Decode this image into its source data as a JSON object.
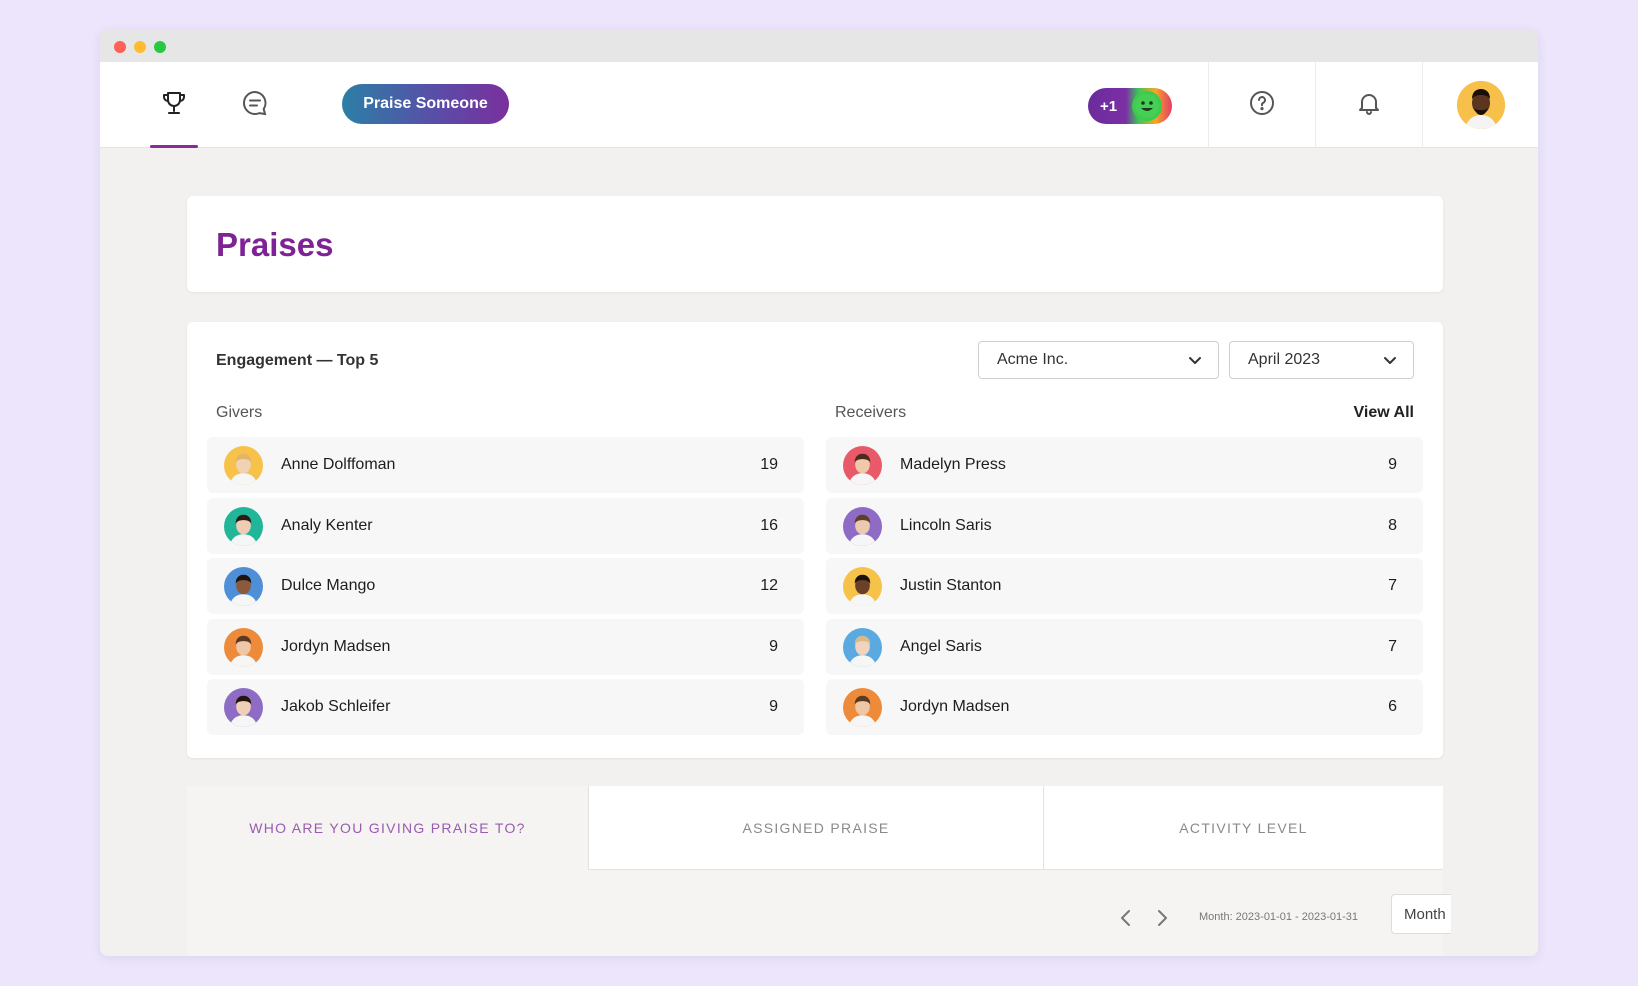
{
  "nav": {
    "praise_button": "Praise Someone",
    "plus_badge": "+1",
    "icons": [
      "trophy-icon",
      "chat-icon",
      "help-icon",
      "bell-icon"
    ]
  },
  "page": {
    "title": "Praises"
  },
  "engagement": {
    "title": "Engagement — Top 5",
    "company_select": "Acme Inc.",
    "month_select": "April 2023",
    "givers_label": "Givers",
    "receivers_label": "Receivers",
    "view_all": "View All",
    "givers": [
      {
        "name": "Anne Dolffoman",
        "count": "19",
        "bg": "#f6c24a",
        "skin": "#f2d2b5",
        "hair": "#e3b46c"
      },
      {
        "name": "Analy Kenter",
        "count": "16",
        "bg": "#21b59a",
        "skin": "#f0cdb2",
        "hair": "#2b1c16"
      },
      {
        "name": "Dulce Mango",
        "count": "12",
        "bg": "#4e8fd8",
        "skin": "#8a5a3c",
        "hair": "#1e1410"
      },
      {
        "name": "Jordyn Madsen",
        "count": "9",
        "bg": "#ee8b3a",
        "skin": "#eec7a6",
        "hair": "#5a3a24"
      },
      {
        "name": "Jakob Schleifer",
        "count": "9",
        "bg": "#8e6cc6",
        "skin": "#efcfb6",
        "hair": "#24160f"
      }
    ],
    "receivers": [
      {
        "name": "Madelyn Press",
        "count": "9",
        "bg": "#e85a6a",
        "skin": "#efc9a9",
        "hair": "#4a2c1c"
      },
      {
        "name": "Lincoln Saris",
        "count": "8",
        "bg": "#8e6cc6",
        "skin": "#eccab0",
        "hair": "#5e3f2a"
      },
      {
        "name": "Justin Stanton",
        "count": "7",
        "bg": "#f6c24a",
        "skin": "#6b4028",
        "hair": "#1c120c"
      },
      {
        "name": "Angel Saris",
        "count": "7",
        "bg": "#5aa9e0",
        "skin": "#f1d4bd",
        "hair": "#d8b98a"
      },
      {
        "name": "Jordyn Madsen",
        "count": "6",
        "bg": "#ee8b3a",
        "skin": "#eec7a6",
        "hair": "#5a3a24"
      }
    ]
  },
  "tabs": {
    "who": "WHO ARE YOU GIVING PRAISE TO?",
    "assigned": "ASSIGNED PRAISE",
    "activity": "ACTIVITY LEVEL"
  },
  "pager": {
    "range": "Month: 2023-01-01 - 2023-01-31",
    "period": "Month"
  },
  "colors": {
    "accent": "#7d2395",
    "background": "#ece5fb"
  }
}
